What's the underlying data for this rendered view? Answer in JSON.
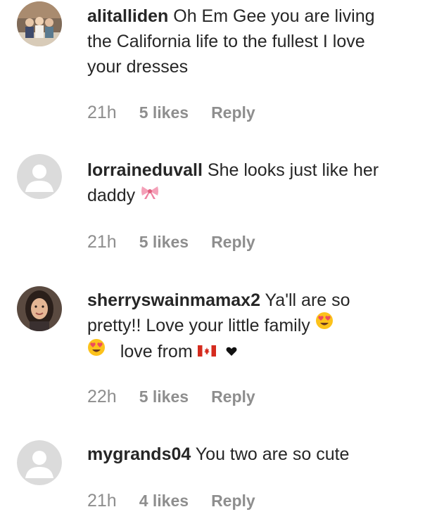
{
  "comments": [
    {
      "username": "alitalliden",
      "text": "Oh Em Gee you are living the California life to the fullest I love your dresses",
      "time": "21h",
      "likes": "5 likes",
      "reply": "Reply",
      "avatar": "photo"
    },
    {
      "username": "lorraineduvall",
      "text": "She looks just like her daddy",
      "emoji_after": "ribbon-emoji",
      "time": "21h",
      "likes": "5 likes",
      "reply": "Reply",
      "avatar": "default"
    },
    {
      "username": "sherryswainmamax2",
      "text_part1": "Ya'll are so pretty!! Love your little family",
      "text_part2": "love from",
      "emojis": [
        "heart-eyes-emoji",
        "heart-eyes-emoji",
        "canada-flag-emoji",
        "black-heart"
      ],
      "time": "22h",
      "likes": "5 likes",
      "reply": "Reply",
      "avatar": "photo"
    },
    {
      "username": "mygrands04",
      "text": "You two are so cute",
      "time": "21h",
      "likes": "4 likes",
      "reply": "Reply",
      "avatar": "default"
    }
  ],
  "colors": {
    "text": "#262626",
    "meta": "#8e8e8e",
    "default_avatar_bg": "#dbdbdb"
  }
}
